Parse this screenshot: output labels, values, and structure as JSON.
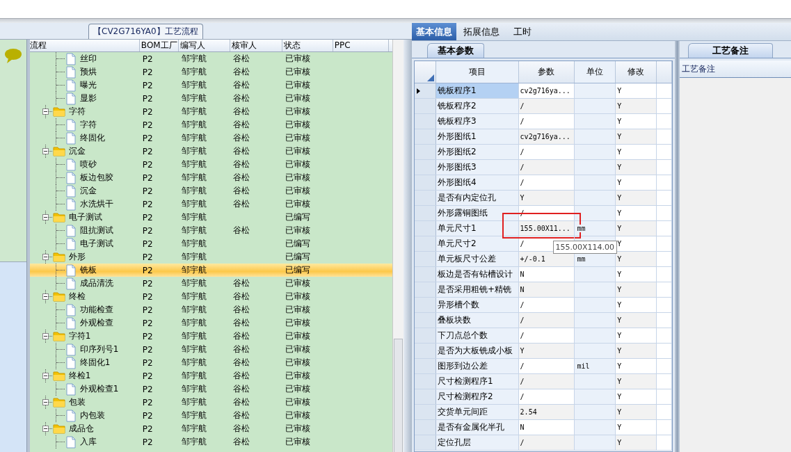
{
  "flow_panel": {
    "title": "【CV2G716YA0】工艺流程"
  },
  "flow_table": {
    "columns": [
      "流程",
      "BOM工厂",
      "编写人",
      "核审人",
      "状态",
      "PPC"
    ],
    "rows": [
      {
        "kind": "file",
        "label": "丝印",
        "factory": "P2",
        "writer": "邹宇航",
        "reviewer": "谷松",
        "status": "已审核",
        "selected": false
      },
      {
        "kind": "file",
        "label": "预烘",
        "factory": "P2",
        "writer": "邹宇航",
        "reviewer": "谷松",
        "status": "已审核",
        "selected": false
      },
      {
        "kind": "file",
        "label": "曝光",
        "factory": "P2",
        "writer": "邹宇航",
        "reviewer": "谷松",
        "status": "已审核",
        "selected": false
      },
      {
        "kind": "file",
        "label": "显影",
        "factory": "P2",
        "writer": "邹宇航",
        "reviewer": "谷松",
        "status": "已审核",
        "selected": false
      },
      {
        "kind": "folder",
        "label": "字符",
        "factory": "P2",
        "writer": "邹宇航",
        "reviewer": "谷松",
        "status": "已审核",
        "selected": false,
        "expanded": true,
        "children": [
          {
            "kind": "file",
            "label": "字符",
            "factory": "P2",
            "writer": "邹宇航",
            "reviewer": "谷松",
            "status": "已审核",
            "selected": false
          },
          {
            "kind": "file",
            "label": "终固化",
            "factory": "P2",
            "writer": "邹宇航",
            "reviewer": "谷松",
            "status": "已审核",
            "selected": false
          }
        ]
      },
      {
        "kind": "folder",
        "label": "沉金",
        "factory": "P2",
        "writer": "邹宇航",
        "reviewer": "谷松",
        "status": "已审核",
        "selected": false,
        "expanded": true,
        "children": [
          {
            "kind": "file",
            "label": "喷砂",
            "factory": "P2",
            "writer": "邹宇航",
            "reviewer": "谷松",
            "status": "已审核",
            "selected": false
          },
          {
            "kind": "file",
            "label": "板边包胶",
            "factory": "P2",
            "writer": "邹宇航",
            "reviewer": "谷松",
            "status": "已审核",
            "selected": false
          },
          {
            "kind": "file",
            "label": "沉金",
            "factory": "P2",
            "writer": "邹宇航",
            "reviewer": "谷松",
            "status": "已审核",
            "selected": false
          },
          {
            "kind": "file",
            "label": "水洗烘干",
            "factory": "P2",
            "writer": "邹宇航",
            "reviewer": "谷松",
            "status": "已审核",
            "selected": false
          }
        ]
      },
      {
        "kind": "folder",
        "label": "电子测试",
        "factory": "P2",
        "writer": "邹宇航",
        "status": "已编写",
        "selected": false,
        "expanded": true,
        "children": [
          {
            "kind": "file",
            "label": "阻抗测试",
            "factory": "P2",
            "writer": "邹宇航",
            "reviewer": "谷松",
            "status": "已审核",
            "selected": false
          },
          {
            "kind": "file",
            "label": "电子测试",
            "factory": "P2",
            "writer": "邹宇航",
            "status": "已编写",
            "selected": false
          }
        ]
      },
      {
        "kind": "folder",
        "label": "外形",
        "factory": "P2",
        "writer": "邹宇航",
        "status": "已编写",
        "selected": false,
        "expanded": true,
        "children": [
          {
            "kind": "file",
            "label": "铣板",
            "factory": "P2",
            "writer": "邹宇航",
            "status": "已编写",
            "selected": true
          },
          {
            "kind": "file",
            "label": "成品清洗",
            "factory": "P2",
            "writer": "邹宇航",
            "reviewer": "谷松",
            "status": "已审核",
            "selected": false
          }
        ]
      },
      {
        "kind": "folder",
        "label": "终检",
        "factory": "P2",
        "writer": "邹宇航",
        "reviewer": "谷松",
        "status": "已审核",
        "selected": false,
        "expanded": true,
        "children": [
          {
            "kind": "file",
            "label": "功能检查",
            "factory": "P2",
            "writer": "邹宇航",
            "reviewer": "谷松",
            "status": "已审核",
            "selected": false
          },
          {
            "kind": "file",
            "label": "外观检查",
            "factory": "P2",
            "writer": "邹宇航",
            "reviewer": "谷松",
            "status": "已审核",
            "selected": false
          }
        ]
      },
      {
        "kind": "folder",
        "label": "字符1",
        "factory": "P2",
        "writer": "邹宇航",
        "reviewer": "谷松",
        "status": "已审核",
        "selected": false,
        "expanded": true,
        "children": [
          {
            "kind": "file",
            "label": "印序列号1",
            "factory": "P2",
            "writer": "邹宇航",
            "reviewer": "谷松",
            "status": "已审核",
            "selected": false
          },
          {
            "kind": "file",
            "label": "终固化1",
            "factory": "P2",
            "writer": "邹宇航",
            "reviewer": "谷松",
            "status": "已审核",
            "selected": false
          }
        ]
      },
      {
        "kind": "folder",
        "label": "终检1",
        "factory": "P2",
        "writer": "邹宇航",
        "reviewer": "谷松",
        "status": "已审核",
        "selected": false,
        "expanded": true,
        "children": [
          {
            "kind": "file",
            "label": "外观检查1",
            "factory": "P2",
            "writer": "邹宇航",
            "reviewer": "谷松",
            "status": "已审核",
            "selected": false
          }
        ]
      },
      {
        "kind": "folder",
        "label": "包装",
        "factory": "P2",
        "writer": "邹宇航",
        "reviewer": "谷松",
        "status": "已审核",
        "selected": false,
        "expanded": true,
        "children": [
          {
            "kind": "file",
            "label": "内包装",
            "factory": "P2",
            "writer": "邹宇航",
            "reviewer": "谷松",
            "status": "已审核",
            "selected": false
          }
        ]
      },
      {
        "kind": "folder",
        "label": "成品仓",
        "factory": "P2",
        "writer": "邹宇航",
        "reviewer": "谷松",
        "status": "已审核",
        "selected": false,
        "expanded": true,
        "children": [
          {
            "kind": "file",
            "label": "入库",
            "factory": "P2",
            "writer": "邹宇航",
            "reviewer": "谷松",
            "status": "已审核",
            "selected": false
          }
        ]
      }
    ]
  },
  "tabs": [
    {
      "label": "基本信息",
      "selected": true
    },
    {
      "label": "拓展信息",
      "selected": false
    },
    {
      "label": "工时",
      "selected": false
    }
  ],
  "params_panel": {
    "tab": "基本参数",
    "columns": [
      "项目",
      "参数",
      "单位",
      "修改"
    ],
    "rows": [
      {
        "item": "铣板程序1",
        "value": "cv2g716ya...",
        "modified": "Y",
        "selected": true
      },
      {
        "item": "铣板程序2",
        "value": "/",
        "modified": "Y",
        "selected": false
      },
      {
        "item": "铣板程序3",
        "value": "/",
        "modified": "Y",
        "selected": false
      },
      {
        "item": "外形图纸1",
        "value": "cv2g716ya...",
        "modified": "Y",
        "selected": false
      },
      {
        "item": "外形图纸2",
        "value": "/",
        "modified": "Y",
        "selected": false
      },
      {
        "item": "外形图纸3",
        "value": "/",
        "modified": "Y",
        "selected": false
      },
      {
        "item": "外形图纸4",
        "value": "/",
        "modified": "Y",
        "selected": false
      },
      {
        "item": "是否有内定位孔",
        "value": "Y",
        "modified": "Y",
        "selected": false
      },
      {
        "item": "外形露铜图纸",
        "value": "/",
        "modified": "Y",
        "selected": false
      },
      {
        "item": "单元尺寸1",
        "value": "155.00X11...",
        "unit": "mm",
        "modified": "Y",
        "selected": false,
        "outlined": true,
        "tooltip": "155.00X114.00"
      },
      {
        "item": "单元尺寸2",
        "value": "/",
        "modified": "Y",
        "selected": false
      },
      {
        "item": "单元板尺寸公差",
        "value": "+/-0.1",
        "unit": "mm",
        "modified": "Y",
        "selected": false
      },
      {
        "item": "板边是否有钻槽设计",
        "value": "N",
        "modified": "Y",
        "selected": false
      },
      {
        "item": "是否采用粗铣+精铣",
        "value": "N",
        "modified": "Y",
        "selected": false
      },
      {
        "item": "异形槽个数",
        "value": "/",
        "modified": "Y",
        "selected": false
      },
      {
        "item": "叠板块数",
        "value": "/",
        "modified": "Y",
        "selected": false
      },
      {
        "item": "下刀点总个数",
        "value": "/",
        "modified": "Y",
        "selected": false
      },
      {
        "item": "是否为大板铣成小板",
        "value": "Y",
        "modified": "Y",
        "selected": false
      },
      {
        "item": "图形到边公差",
        "value": "/",
        "unit": "mil",
        "modified": "Y",
        "selected": false
      },
      {
        "item": "尺寸检测程序1",
        "value": "/",
        "modified": "Y",
        "selected": false
      },
      {
        "item": "尺寸检测程序2",
        "value": "/",
        "modified": "Y",
        "selected": false
      },
      {
        "item": "交货单元间距",
        "value": "2.54",
        "modified": "Y",
        "selected": false
      },
      {
        "item": "是否有金属化半孔",
        "value": "N",
        "modified": "Y",
        "selected": false
      },
      {
        "item": "定位孔层",
        "value": "/",
        "modified": "Y",
        "selected": false
      }
    ]
  },
  "notes_panel": {
    "tab": "工艺备注",
    "header": "工艺备注"
  }
}
